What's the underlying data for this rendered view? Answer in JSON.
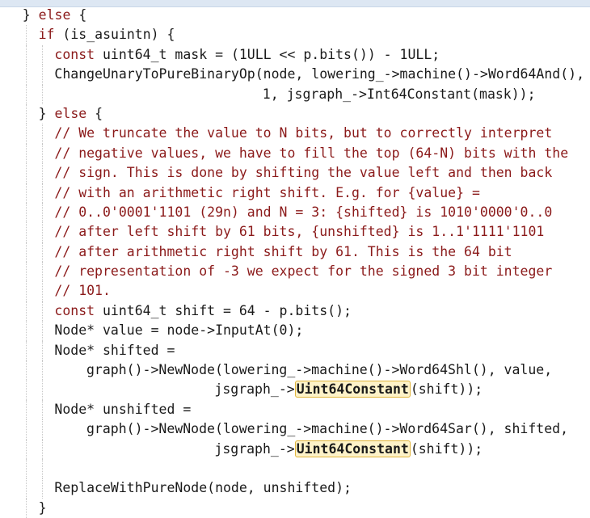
{
  "editor": {
    "lines": [
      {
        "indent": 2,
        "segments": [
          {
            "t": "} ",
            "c": ""
          },
          {
            "t": "else",
            "c": "kw"
          },
          {
            "t": " {",
            "c": ""
          }
        ]
      },
      {
        "indent": 4,
        "segments": [
          {
            "t": "if",
            "c": "kw"
          },
          {
            "t": " (is_asuintn) {",
            "c": ""
          }
        ]
      },
      {
        "indent": 6,
        "segments": [
          {
            "t": "const",
            "c": "kw"
          },
          {
            "t": " uint64_t mask = (1ULL << p.bits()) - 1ULL;",
            "c": ""
          }
        ]
      },
      {
        "indent": 6,
        "segments": [
          {
            "t": "ChangeUnaryToPureBinaryOp(node, lowering_->machine()->Word64And(),",
            "c": ""
          }
        ]
      },
      {
        "indent": 32,
        "segments": [
          {
            "t": "1, jsgraph_->Int64Constant(mask));",
            "c": ""
          }
        ]
      },
      {
        "indent": 4,
        "segments": [
          {
            "t": "} ",
            "c": ""
          },
          {
            "t": "else",
            "c": "kw"
          },
          {
            "t": " {",
            "c": ""
          }
        ]
      },
      {
        "indent": 6,
        "segments": [
          {
            "t": "// We truncate the value to N bits, but to correctly interpret",
            "c": "cm"
          }
        ]
      },
      {
        "indent": 6,
        "segments": [
          {
            "t": "// negative values, we have to fill the top (64-N) bits with the",
            "c": "cm"
          }
        ]
      },
      {
        "indent": 6,
        "segments": [
          {
            "t": "// sign. This is done by shifting the value left and then back",
            "c": "cm"
          }
        ]
      },
      {
        "indent": 6,
        "segments": [
          {
            "t": "// with an arithmetic right shift. E.g. for {value} =",
            "c": "cm"
          }
        ]
      },
      {
        "indent": 6,
        "segments": [
          {
            "t": "// 0..0'0001'1101 (29n) and N = 3: {shifted} is 1010'0000'0..0",
            "c": "cm"
          }
        ]
      },
      {
        "indent": 6,
        "segments": [
          {
            "t": "// after left shift by 61 bits, {unshifted} is 1..1'1111'1101",
            "c": "cm"
          }
        ]
      },
      {
        "indent": 6,
        "segments": [
          {
            "t": "// after arithmetic right shift by 61. This is the 64 bit",
            "c": "cm"
          }
        ]
      },
      {
        "indent": 6,
        "segments": [
          {
            "t": "// representation of -3 we expect for the signed 3 bit integer",
            "c": "cm"
          }
        ]
      },
      {
        "indent": 6,
        "segments": [
          {
            "t": "// 101.",
            "c": "cm"
          }
        ]
      },
      {
        "indent": 6,
        "segments": [
          {
            "t": "const",
            "c": "kw"
          },
          {
            "t": " uint64_t shift = 64 - p.bits();",
            "c": ""
          }
        ]
      },
      {
        "indent": 6,
        "segments": [
          {
            "t": "Node* value = node->InputAt(0);",
            "c": ""
          }
        ]
      },
      {
        "indent": 6,
        "segments": [
          {
            "t": "Node* shifted =",
            "c": ""
          }
        ]
      },
      {
        "indent": 10,
        "segments": [
          {
            "t": "graph()->NewNode(lowering_->machine()->Word64Shl(), value,",
            "c": ""
          }
        ]
      },
      {
        "indent": 26,
        "segments": [
          {
            "t": "jsgraph_->",
            "c": ""
          },
          {
            "t": "Uint64Constant",
            "c": "hl"
          },
          {
            "t": "(shift));",
            "c": ""
          }
        ]
      },
      {
        "indent": 6,
        "segments": [
          {
            "t": "Node* unshifted =",
            "c": ""
          }
        ]
      },
      {
        "indent": 10,
        "segments": [
          {
            "t": "graph()->NewNode(lowering_->machine()->Word64Sar(), shifted,",
            "c": ""
          }
        ]
      },
      {
        "indent": 26,
        "segments": [
          {
            "t": "jsgraph_->",
            "c": ""
          },
          {
            "t": "Uint64Constant",
            "c": "hl"
          },
          {
            "t": "(shift));",
            "c": ""
          }
        ]
      },
      {
        "indent": 0,
        "segments": []
      },
      {
        "indent": 6,
        "segments": [
          {
            "t": "ReplaceWithPureNode(node, unshifted);",
            "c": ""
          }
        ]
      },
      {
        "indent": 4,
        "segments": [
          {
            "t": "}",
            "c": ""
          }
        ]
      }
    ]
  }
}
